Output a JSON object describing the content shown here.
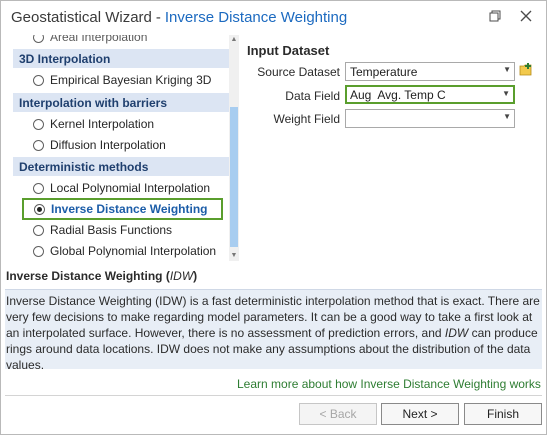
{
  "window": {
    "app_title": "Geostatistical Wizard",
    "separator": "-",
    "subtitle": "Inverse Distance Weighting"
  },
  "methods": {
    "partial_item": "Areal Interpolation",
    "groups": [
      {
        "header": "3D Interpolation",
        "items": [
          "Empirical Bayesian Kriging 3D"
        ]
      },
      {
        "header": "Interpolation with barriers",
        "items": [
          "Kernel Interpolation",
          "Diffusion Interpolation"
        ]
      },
      {
        "header": "Deterministic methods",
        "items": [
          "Local Polynomial Interpolation",
          "Inverse Distance Weighting",
          "Radial Basis Functions",
          "Global Polynomial Interpolation"
        ]
      }
    ],
    "selected": "Inverse Distance Weighting"
  },
  "input_dataset": {
    "title": "Input Dataset",
    "source_label": "Source Dataset",
    "source_value": "Temperature",
    "data_field_label": "Data Field",
    "data_field_value": "Aug  Avg. Temp C",
    "weight_field_label": "Weight Field",
    "weight_field_value": ""
  },
  "description": {
    "title": "Inverse Distance Weighting",
    "abbr": "IDW",
    "text_1": "Inverse Distance Weighting (IDW) is a fast deterministic interpolation method that is exact. There are very few decisions to make regarding model parameters. It can be a good way to take a first look at an interpolated surface. However, there is no assessment of prediction errors, and ",
    "text_em": "IDW",
    "text_2": " can produce rings around data locations. IDW does not make any assumptions about the distribution of the data values.",
    "learn_more": "Learn more about how Inverse Distance Weighting works"
  },
  "footer": {
    "back_label": "< Back",
    "next_label": "Next >",
    "finish_label": "Finish"
  },
  "colors": {
    "accent_blue": "#1c6ac0",
    "highlight_green": "#5a9e2d",
    "group_header_bg": "#dce5f3",
    "scroll_thumb": "#a8cdf0"
  }
}
